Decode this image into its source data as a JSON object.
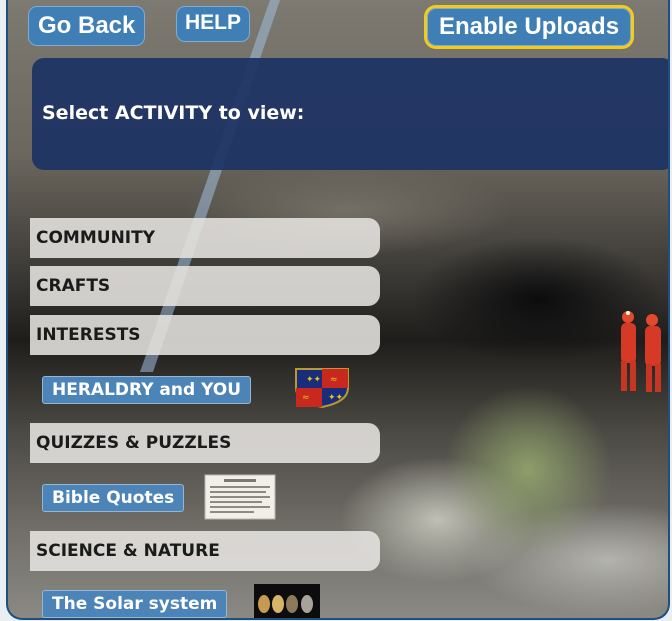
{
  "top_bar": {
    "go_back_label": "Go Back",
    "help_label": "HELP",
    "enable_uploads_label": "Enable Uploads"
  },
  "panel": {
    "prompt": "Select ACTIVITY to view:"
  },
  "categories": [
    {
      "label": "COMMUNITY"
    },
    {
      "label": "CRAFTS"
    },
    {
      "label": "INTERESTS"
    },
    {
      "label": "QUIZZES & PUZZLES"
    },
    {
      "label": "SCIENCE & NATURE"
    }
  ],
  "activities": [
    {
      "label": "HERALDRY and YOU",
      "thumb": "heraldry-shield-icon"
    },
    {
      "label": "Bible Quotes",
      "thumb": "document-thumbnail"
    },
    {
      "label": "The Solar system",
      "thumb": "planets-thumbnail"
    }
  ],
  "colors": {
    "button_blue": "#3f7fb6",
    "panel_navy": "#1c3264",
    "upload_border": "#f2cc18",
    "frame_border": "#1f4f7a"
  }
}
